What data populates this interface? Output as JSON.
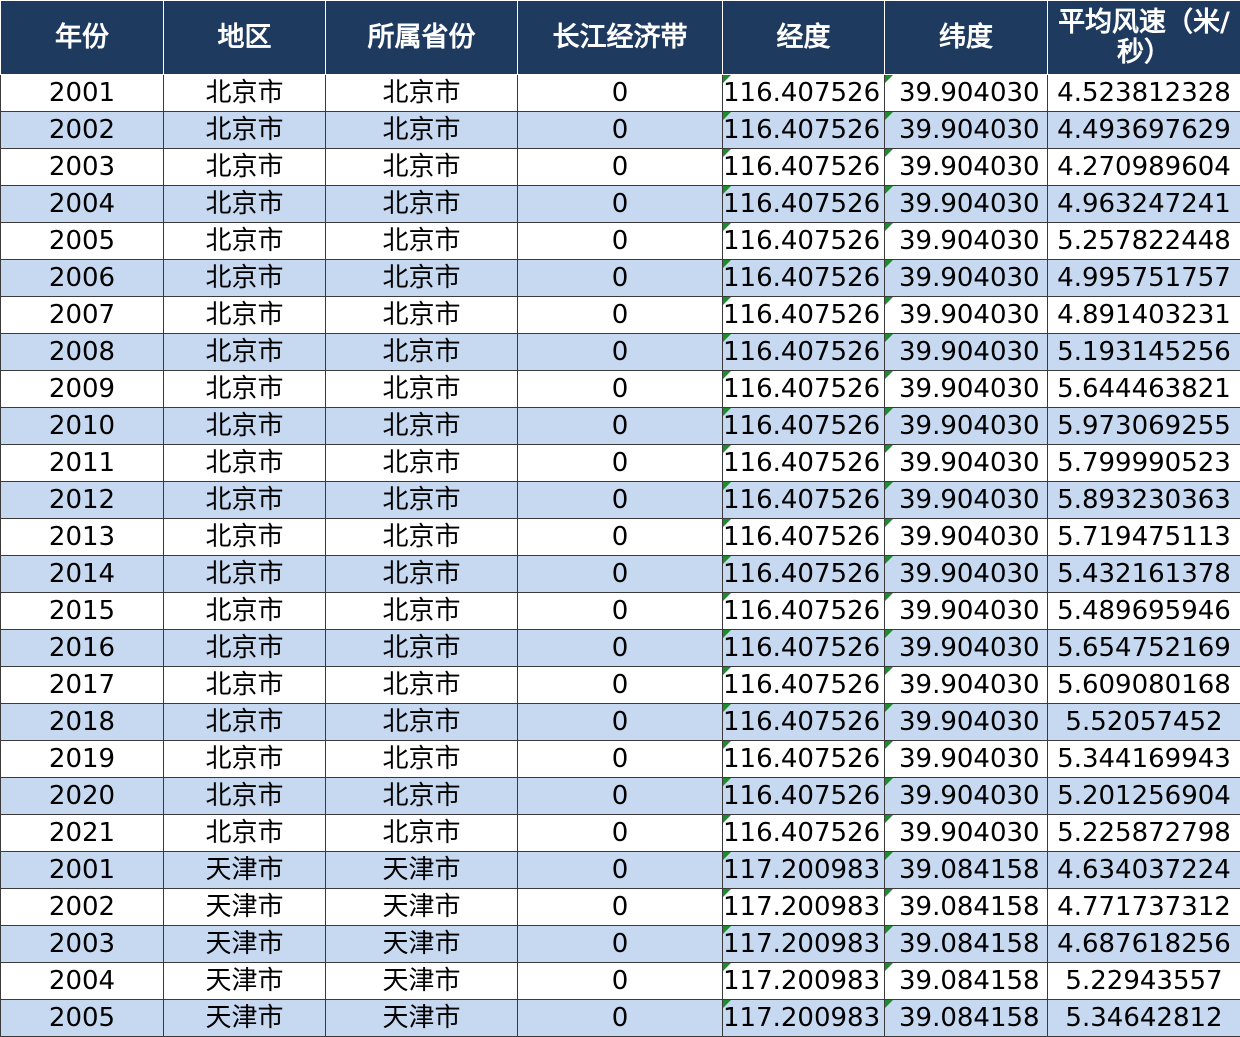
{
  "headers": [
    "年份",
    "地区",
    "所属省份",
    "长江经济带",
    "经度",
    "纬度",
    "平均风速（米/秒）"
  ],
  "rows": [
    [
      "2001",
      "北京市",
      "北京市",
      "0",
      "116.407526",
      "39.904030",
      "4.523812328"
    ],
    [
      "2002",
      "北京市",
      "北京市",
      "0",
      "116.407526",
      "39.904030",
      "4.493697629"
    ],
    [
      "2003",
      "北京市",
      "北京市",
      "0",
      "116.407526",
      "39.904030",
      "4.270989604"
    ],
    [
      "2004",
      "北京市",
      "北京市",
      "0",
      "116.407526",
      "39.904030",
      "4.963247241"
    ],
    [
      "2005",
      "北京市",
      "北京市",
      "0",
      "116.407526",
      "39.904030",
      "5.257822448"
    ],
    [
      "2006",
      "北京市",
      "北京市",
      "0",
      "116.407526",
      "39.904030",
      "4.995751757"
    ],
    [
      "2007",
      "北京市",
      "北京市",
      "0",
      "116.407526",
      "39.904030",
      "4.891403231"
    ],
    [
      "2008",
      "北京市",
      "北京市",
      "0",
      "116.407526",
      "39.904030",
      "5.193145256"
    ],
    [
      "2009",
      "北京市",
      "北京市",
      "0",
      "116.407526",
      "39.904030",
      "5.644463821"
    ],
    [
      "2010",
      "北京市",
      "北京市",
      "0",
      "116.407526",
      "39.904030",
      "5.973069255"
    ],
    [
      "2011",
      "北京市",
      "北京市",
      "0",
      "116.407526",
      "39.904030",
      "5.799990523"
    ],
    [
      "2012",
      "北京市",
      "北京市",
      "0",
      "116.407526",
      "39.904030",
      "5.893230363"
    ],
    [
      "2013",
      "北京市",
      "北京市",
      "0",
      "116.407526",
      "39.904030",
      "5.719475113"
    ],
    [
      "2014",
      "北京市",
      "北京市",
      "0",
      "116.407526",
      "39.904030",
      "5.432161378"
    ],
    [
      "2015",
      "北京市",
      "北京市",
      "0",
      "116.407526",
      "39.904030",
      "5.489695946"
    ],
    [
      "2016",
      "北京市",
      "北京市",
      "0",
      "116.407526",
      "39.904030",
      "5.654752169"
    ],
    [
      "2017",
      "北京市",
      "北京市",
      "0",
      "116.407526",
      "39.904030",
      "5.609080168"
    ],
    [
      "2018",
      "北京市",
      "北京市",
      "0",
      "116.407526",
      "39.904030",
      "5.52057452"
    ],
    [
      "2019",
      "北京市",
      "北京市",
      "0",
      "116.407526",
      "39.904030",
      "5.344169943"
    ],
    [
      "2020",
      "北京市",
      "北京市",
      "0",
      "116.407526",
      "39.904030",
      "5.201256904"
    ],
    [
      "2021",
      "北京市",
      "北京市",
      "0",
      "116.407526",
      "39.904030",
      "5.225872798"
    ],
    [
      "2001",
      "天津市",
      "天津市",
      "0",
      "117.200983",
      "39.084158",
      "4.634037224"
    ],
    [
      "2002",
      "天津市",
      "天津市",
      "0",
      "117.200983",
      "39.084158",
      "4.771737312"
    ],
    [
      "2003",
      "天津市",
      "天津市",
      "0",
      "117.200983",
      "39.084158",
      "4.687618256"
    ],
    [
      "2004",
      "天津市",
      "天津市",
      "0",
      "117.200983",
      "39.084158",
      "5.22943557"
    ],
    [
      "2005",
      "天津市",
      "天津市",
      "0",
      "117.200983",
      "39.084158",
      "5.34642812"
    ]
  ]
}
